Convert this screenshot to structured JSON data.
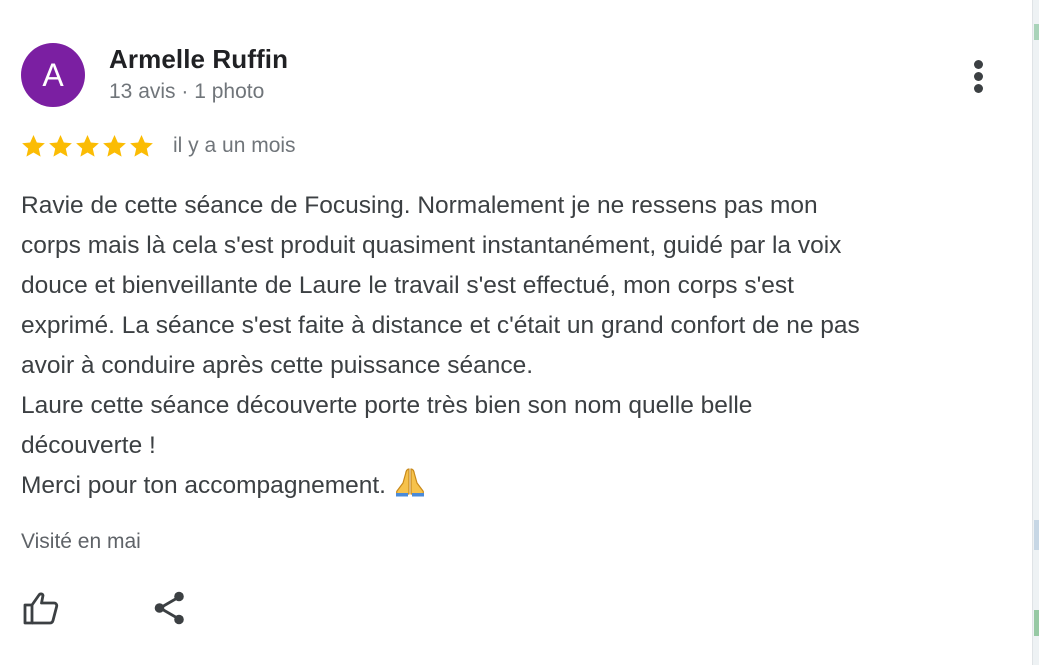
{
  "review": {
    "author": {
      "initial": "A",
      "name": "Armelle Ruffin",
      "meta": "13 avis · 1 photo",
      "avatar_color": "#7b1fa2"
    },
    "rating": 5,
    "star_color": "#fbbc04",
    "time_ago": "il y a un mois",
    "body_lines": [
      "Ravie de cette séance de Focusing. Normalement je ne ressens pas mon",
      "corps mais là cela s'est produit quasiment instantanément, guidé par la voix",
      "douce et bienveillante de Laure le travail s'est effectué, mon corps s'est",
      "exprimé. La séance s'est faite à distance et c'était un grand confort de ne pas",
      "avoir à conduire après cette puissance séance.",
      "Laure cette séance découverte porte très bien son nom quelle belle",
      "découverte !",
      "Merci pour ton accompagnement."
    ],
    "emoji": "folded-hands",
    "visited": "Visité en mai"
  },
  "actions": {
    "more_icon": "more-vert-icon",
    "like_icon": "thumb-up-icon",
    "share_icon": "share-icon"
  }
}
